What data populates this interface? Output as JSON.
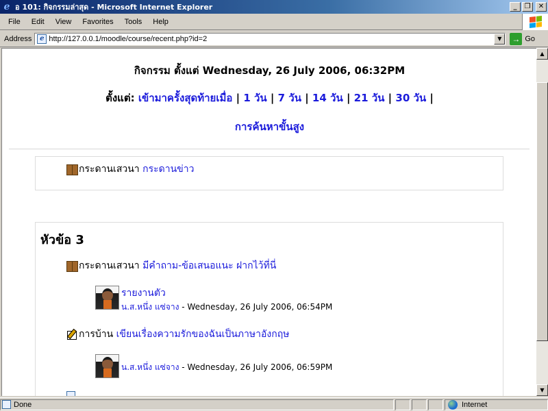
{
  "window": {
    "title": "อ 101: กิจกรรมล่าสุด - Microsoft Internet Explorer",
    "buttons": [
      "_",
      "❐",
      "✕"
    ]
  },
  "menu": [
    "File",
    "Edit",
    "View",
    "Favorites",
    "Tools",
    "Help"
  ],
  "address": {
    "label": "Address",
    "url": "http://127.0.0.1/moodle/course/recent.php?id=2",
    "go_label": "Go"
  },
  "page": {
    "heading": "กิจกรรม ตั้งแต่ Wednesday, 26 July 2006, 06:32PM",
    "since_label": "ตั้งแต่:",
    "since_links": [
      "เข้ามาครั้งสุดท้ายเมื่อ",
      "1 วัน",
      "7 วัน",
      "14 วัน",
      "21 วัน",
      "30 วัน"
    ],
    "sep": "|",
    "advanced_search": "การค้นหาขั้นสูง",
    "general_section": {
      "activity_type": "กระดานเสวนา",
      "activity_name": "กระดานข่าว"
    },
    "section3": {
      "title": "หัวข้อ 3",
      "forum": {
        "type": "กระดานเสวนา",
        "name": "มีคำถาม-ข้อเสนอแนะ ฝากไว้ที่นี่",
        "post_subject": "รายงานตัว",
        "post_author": "น.ส.หนึ่ง แซ่จาง",
        "post_date": " - Wednesday, 26 July 2006, 06:54PM"
      },
      "assignment": {
        "type": "การบ้าน",
        "name": "เขียนเรื่องความรักของฉันเป็นภาษาอังกฤษ",
        "submit_author": "น.ส.หนึ่ง แซ่จาง",
        "submit_date": " - Wednesday, 26 July 2006, 06:59PM"
      }
    }
  },
  "status": {
    "text": "Done",
    "zone": "Internet"
  },
  "colors": {
    "link": "#1a1adb",
    "titlebar_start": "#0a246a",
    "chrome": "#d4d0c8"
  }
}
